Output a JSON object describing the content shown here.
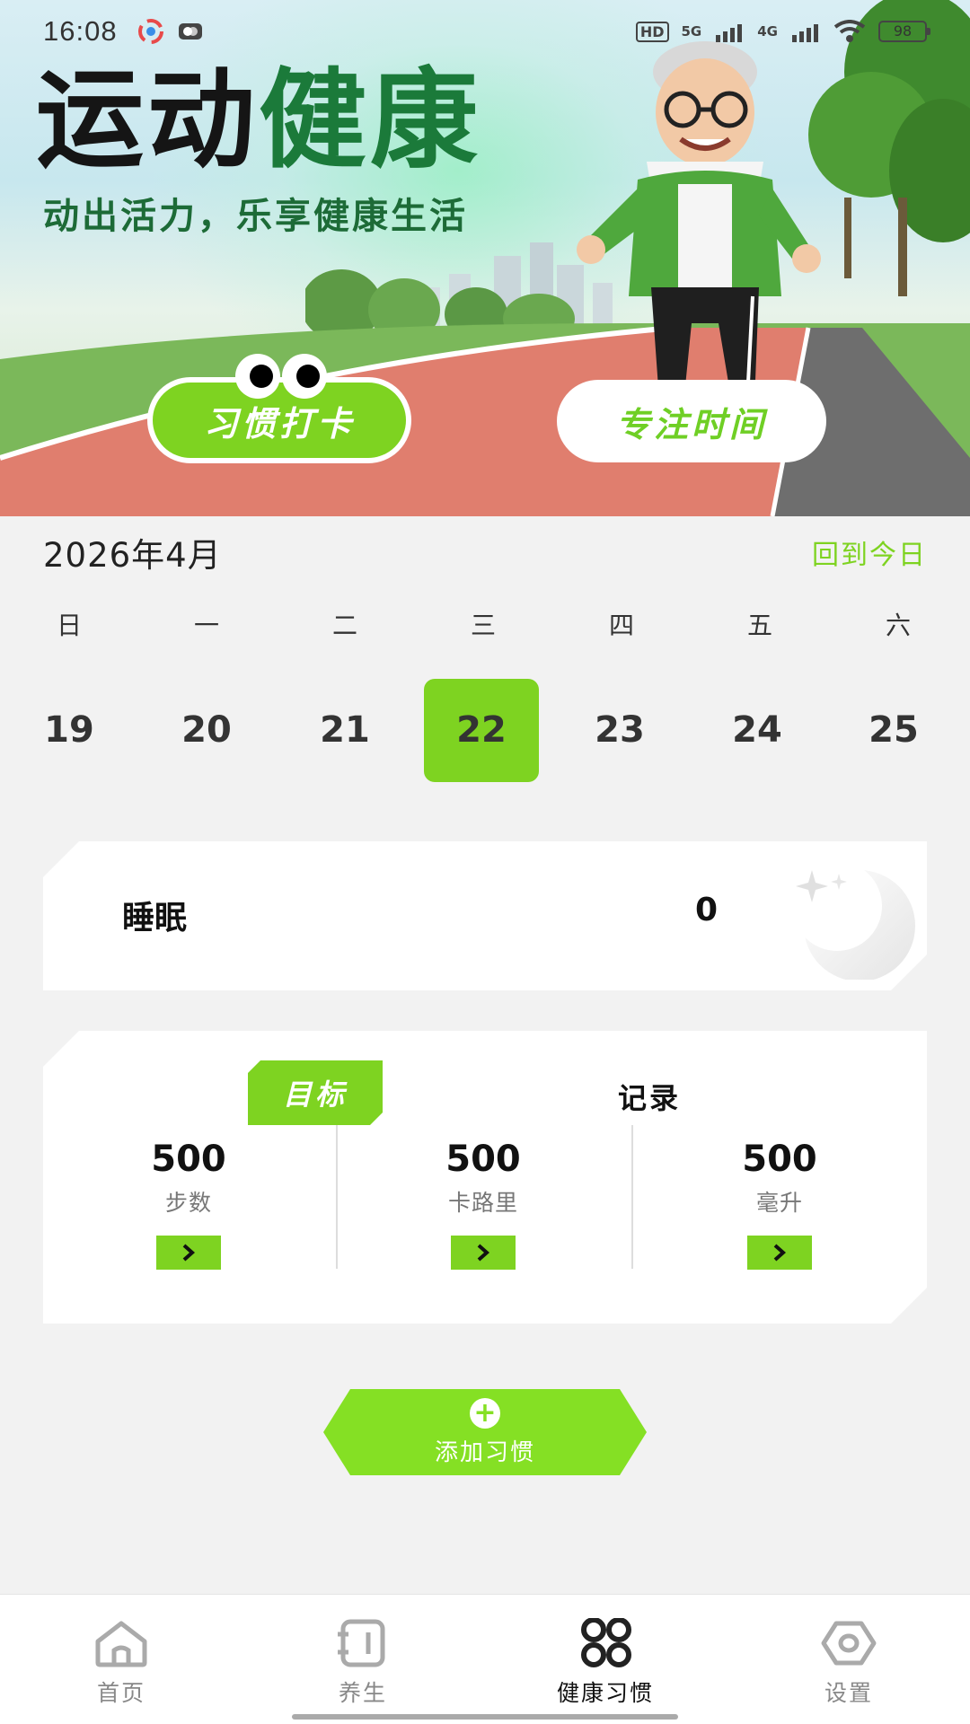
{
  "status_bar": {
    "time": "16:08",
    "badges": [
      "HD",
      "5G",
      "4G"
    ],
    "battery": "98"
  },
  "hero": {
    "title_black": "运动",
    "title_green": "健康",
    "subtitle": "动出活力，乐享健康生活",
    "habit_button": "习惯打卡",
    "focus_button": "专注时间"
  },
  "calendar": {
    "month": "2026年4月",
    "back_today": "回到今日",
    "weekdays": [
      "日",
      "一",
      "二",
      "三",
      "四",
      "五",
      "六"
    ],
    "dates": [
      "19",
      "20",
      "21",
      "22",
      "23",
      "24",
      "25"
    ],
    "selected_date": "22"
  },
  "sleep": {
    "label": "睡眠",
    "value": "0"
  },
  "targets": {
    "tab_target": "目标",
    "tab_record": "记录",
    "metrics": [
      {
        "value": "500",
        "unit": "步数"
      },
      {
        "value": "500",
        "unit": "卡路里"
      },
      {
        "value": "500",
        "unit": "毫升"
      }
    ]
  },
  "add_habit": {
    "label": "添加习惯"
  },
  "bottom_nav": [
    {
      "label": "首页",
      "icon": "home-icon"
    },
    {
      "label": "养生",
      "icon": "notebook-icon"
    },
    {
      "label": "健康习惯",
      "icon": "grid-icon",
      "active": true
    },
    {
      "label": "设置",
      "icon": "settings-icon"
    }
  ],
  "colors": {
    "accent": "#7ed321",
    "hero_green": "#1b7a3a",
    "background": "#f2f2f2"
  }
}
